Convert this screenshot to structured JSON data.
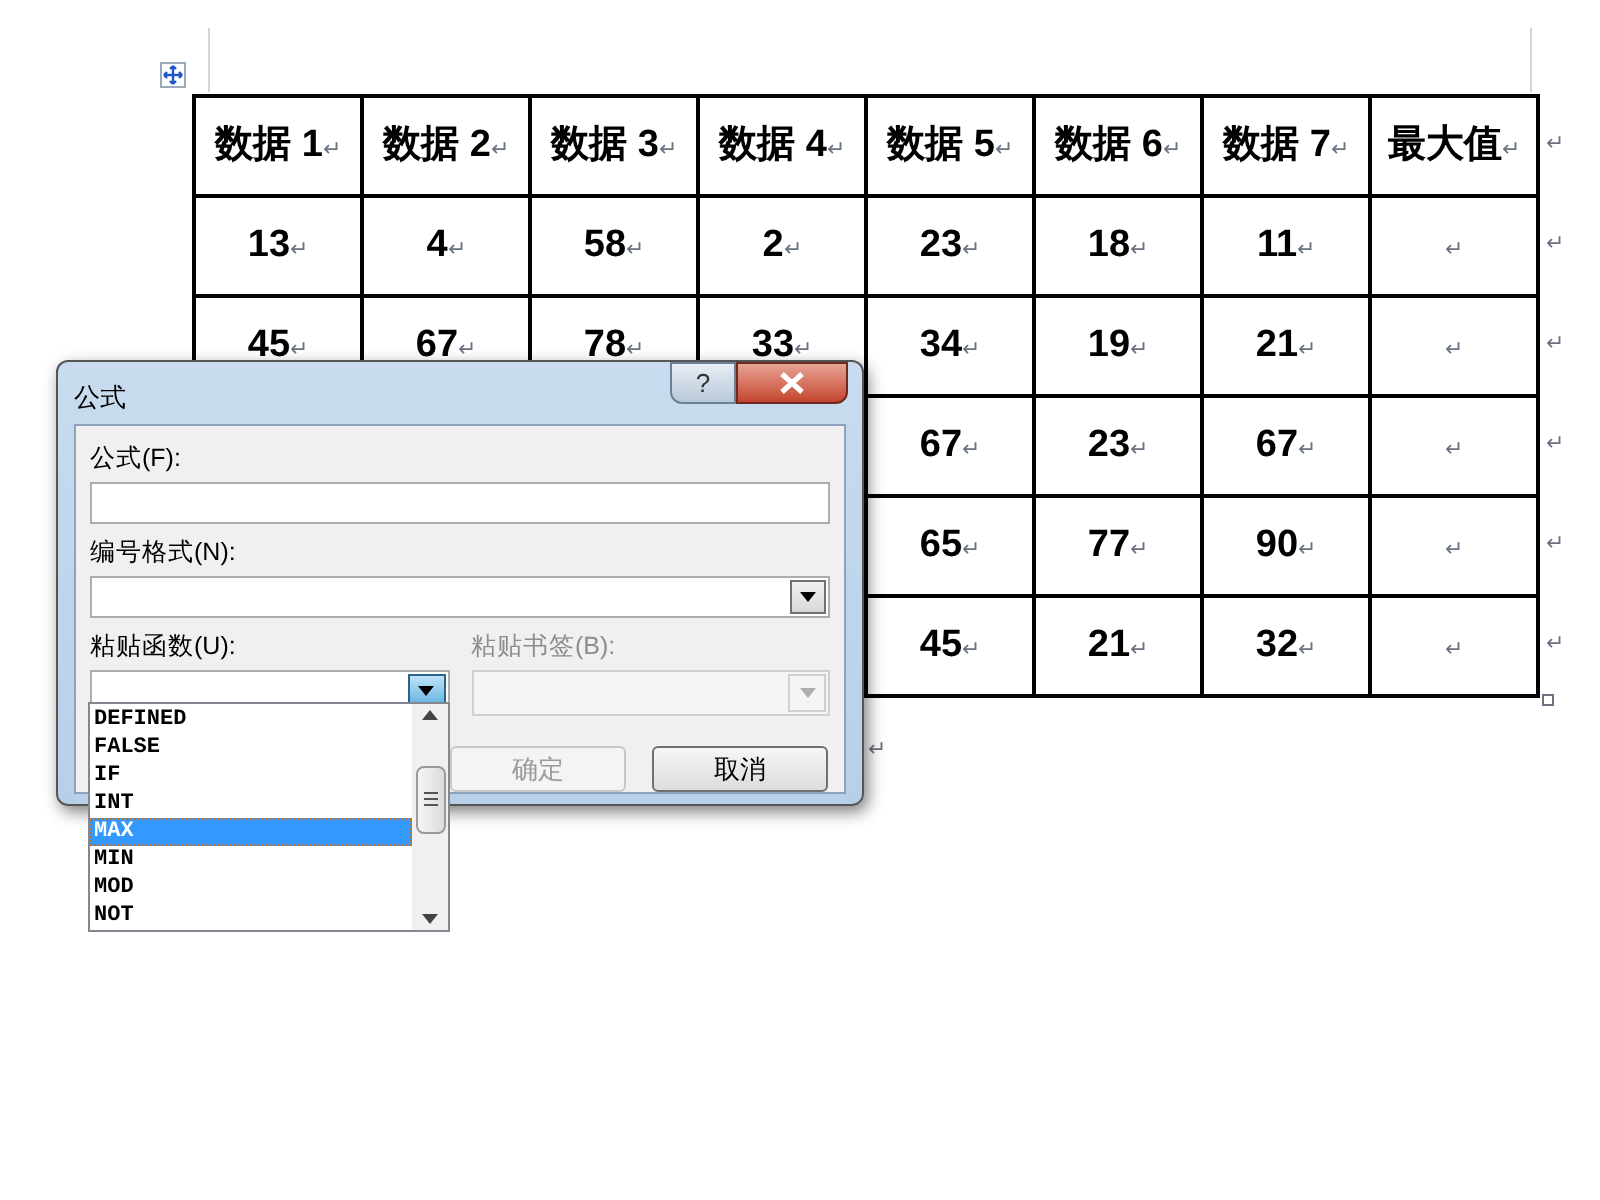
{
  "document": {
    "table": {
      "columns": [
        "数据 1↵",
        "数据 2↵",
        "数据 3↵",
        "数据 4↵",
        "数据 5↵",
        "数据 6↵",
        "数据 7↵",
        "最大值↵"
      ],
      "rows": [
        {
          "cells": [
            "13↵",
            "4↵",
            "58↵",
            "2↵",
            "23↵",
            "18↵",
            "11↵",
            "↵"
          ]
        },
        {
          "cells": [
            "45↵",
            "67↵",
            "78↵",
            "33↵",
            "34↵",
            "19↵",
            "21↵",
            "↵"
          ]
        },
        {
          "cells": [
            null,
            null,
            null,
            null,
            "67↵",
            "23↵",
            "67↵",
            "↵"
          ]
        },
        {
          "cells": [
            null,
            null,
            null,
            null,
            "65↵",
            "77↵",
            "90↵",
            "↵"
          ]
        },
        {
          "cells": [
            null,
            null,
            null,
            null,
            "45↵",
            "21↵",
            "32↵",
            "↵"
          ]
        }
      ]
    },
    "row_end_marks": [
      "↵",
      "↵",
      "↵",
      "↵",
      "↵",
      "↵"
    ],
    "paragraph_mark": "↵"
  },
  "dialog": {
    "title": "公式",
    "help_button": "?",
    "formula_field": {
      "label": "公式(F):"
    },
    "number_format": {
      "label": "编号格式(N):"
    },
    "paste_function": {
      "label": "粘贴函数(U):",
      "expanded": true,
      "options": [
        {
          "text": "DEFINED",
          "selected": false
        },
        {
          "text": "FALSE",
          "selected": false
        },
        {
          "text": "IF",
          "selected": false
        },
        {
          "text": "INT",
          "selected": false
        },
        {
          "text": "MAX",
          "selected": true
        },
        {
          "text": "MIN",
          "selected": false
        },
        {
          "text": "MOD",
          "selected": false
        },
        {
          "text": "NOT",
          "selected": false
        }
      ]
    },
    "paste_bookmark": {
      "label": "粘贴书签(B):",
      "disabled": true
    },
    "buttons": [
      {
        "label": "确定",
        "disabled": true
      },
      {
        "label": "取消",
        "disabled": false
      }
    ]
  }
}
